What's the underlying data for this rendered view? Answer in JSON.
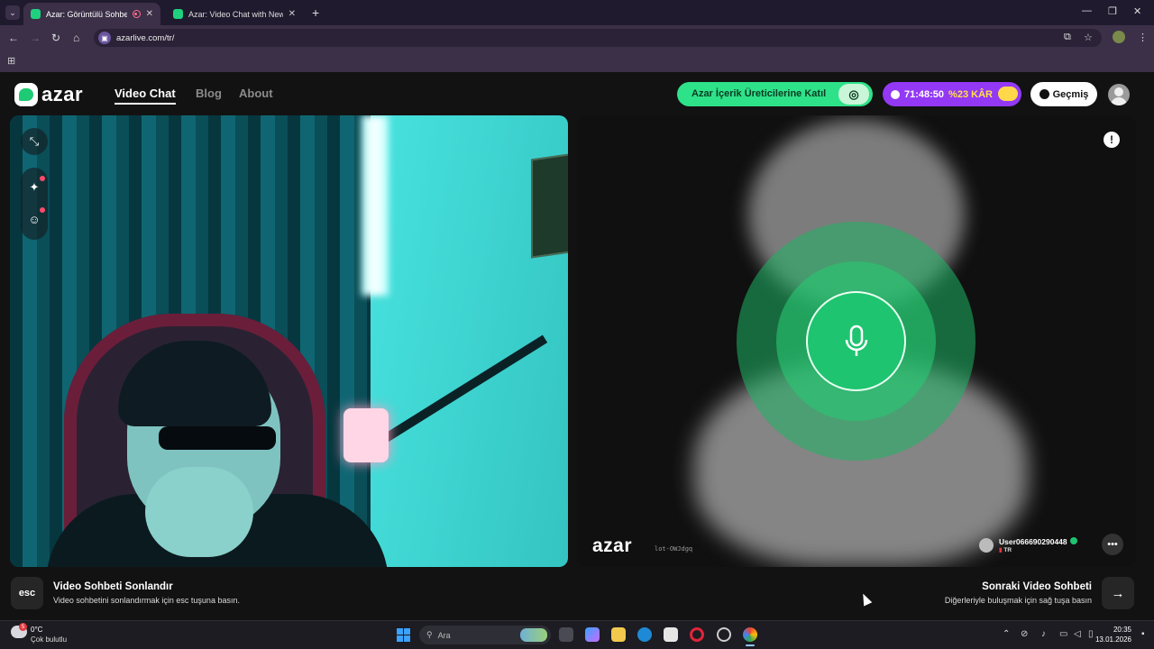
{
  "browser": {
    "tabs": [
      {
        "title": "Azar: Görüntülü Sohbet & Y",
        "active": true,
        "recording": true
      },
      {
        "title": "Azar: Video Chat with New Peo",
        "active": false
      }
    ],
    "url": "azarlive.com/tr/"
  },
  "header": {
    "logo_text": "azar",
    "nav": [
      {
        "label": "Video Chat",
        "active": true
      },
      {
        "label": "Blog",
        "active": false
      },
      {
        "label": "About",
        "active": false
      }
    ],
    "creator_button": "Azar İçerik Üreticilerine Katıl",
    "promo": {
      "timer": "71:48:50",
      "discount": "%23 KÂR"
    },
    "history_button": "Geçmiş"
  },
  "remote": {
    "watermark": "azar",
    "watermark_code": "lot-OWJdgq",
    "username": "User066690290448",
    "country": "TR"
  },
  "bottom": {
    "esc_key": "esc",
    "end_title": "Video Sohbeti Sonlandır",
    "end_subtitle": "Video sohbetini sonlandırmak için esc tuşuna basın.",
    "next_title": "Sonraki Video Sohbeti",
    "next_subtitle": "Diğerleriyle buluşmak için sağ tuşa basın",
    "next_key": "→"
  },
  "taskbar": {
    "weather_badge": "5",
    "temperature": "0°C",
    "condition": "Çok bulutlu",
    "search_placeholder": "Ara",
    "time": "20:35",
    "date": "13.01.2026"
  },
  "colors": {
    "accent": "#1ec46f",
    "promo": "#9338f5",
    "creator": "#2ee28a"
  }
}
